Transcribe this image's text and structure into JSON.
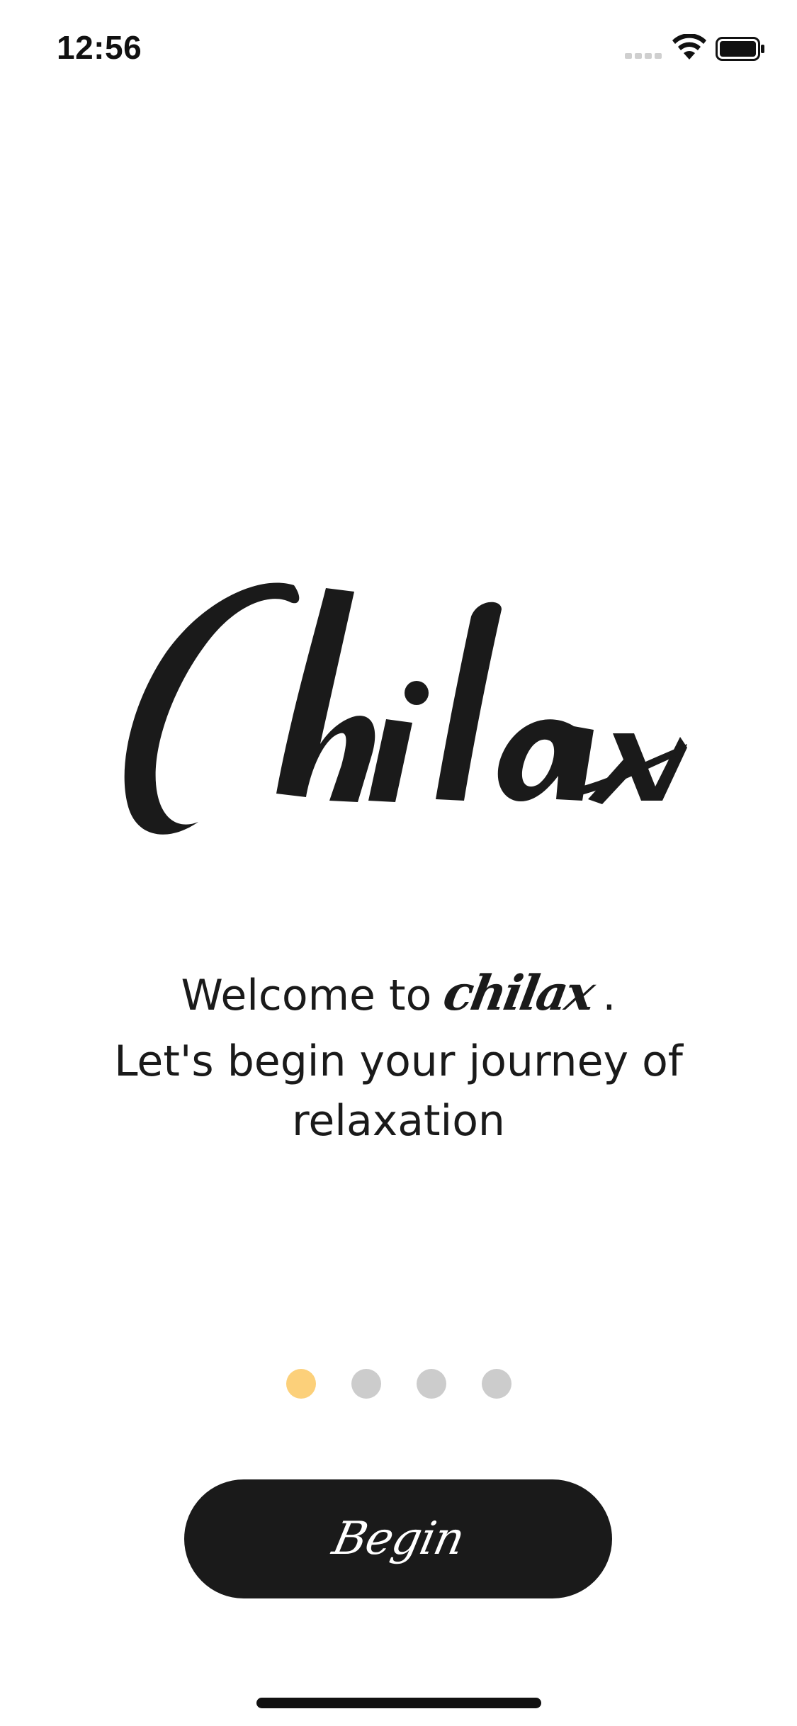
{
  "status_bar": {
    "time": "12:56",
    "signal_icon": "cellular-signal-icon",
    "wifi_icon": "wifi-icon",
    "battery_icon": "battery-icon"
  },
  "logo": {
    "text": "Chilax",
    "color": "#1a1a1a"
  },
  "welcome": {
    "prefix": "Welcome to",
    "brand": "chilax",
    "suffix": ".",
    "subtitle": "Let's begin your journey of relaxation"
  },
  "pager": {
    "total": 4,
    "active_index": 0,
    "active_color": "#fcd07a",
    "inactive_color": "#cccccc"
  },
  "actions": {
    "begin_label": "Begin",
    "button_color": "#1a1a1a"
  }
}
